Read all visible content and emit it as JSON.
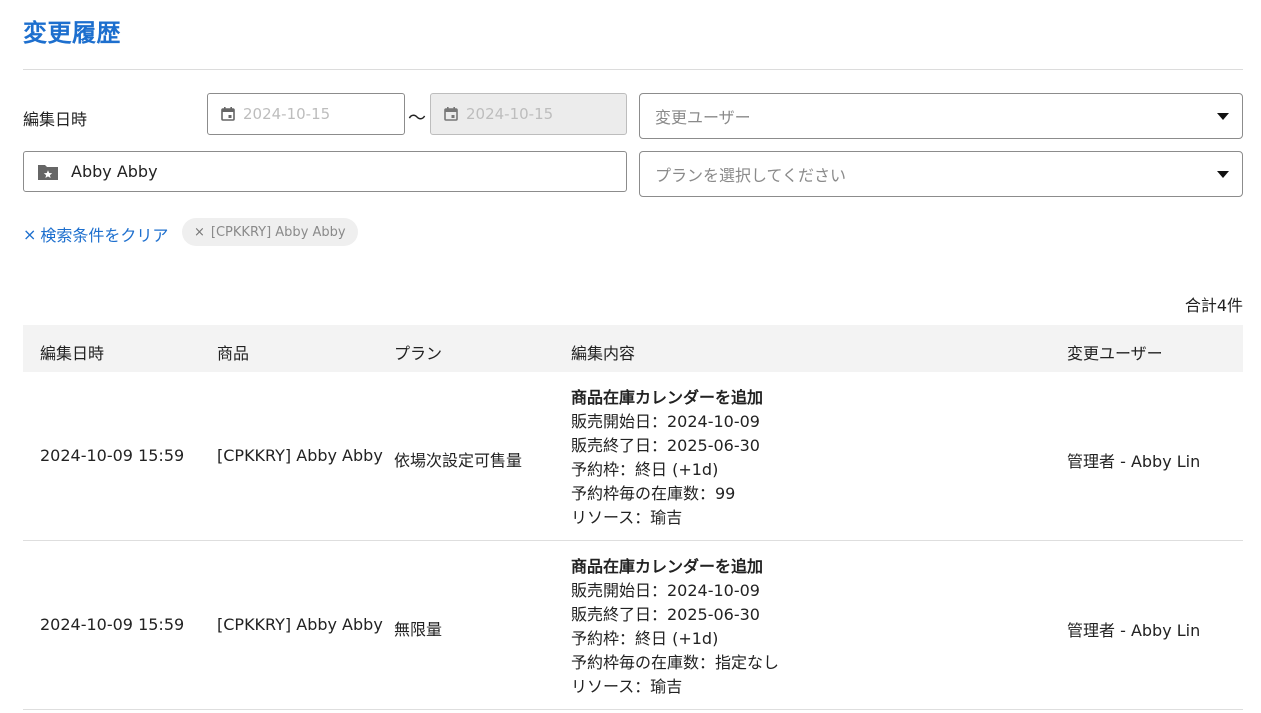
{
  "page": {
    "title": "変更履歴"
  },
  "filters": {
    "edit_date_label": "編集日時",
    "date_from_placeholder": "2024-10-15",
    "date_separator": "〜",
    "date_to_placeholder": "2024-10-15",
    "user_placeholder": "変更ユーザー",
    "product_value": "Abby Abby",
    "plan_placeholder": "プランを選択してください",
    "clear_label": "検索条件をクリア",
    "clear_symbol": "×",
    "chip_label": "[CPKKRY] Abby Abby",
    "chip_symbol": "×"
  },
  "summary": {
    "total": "合計4件"
  },
  "table": {
    "headers": [
      "編集日時",
      "商品",
      "プラン",
      "編集内容",
      "変更ユーザー"
    ],
    "rows": [
      {
        "datetime": "2024-10-09 15:59",
        "product": "[CPKKRY] Abby Abby",
        "plan": "依場次設定可售量",
        "content_title": "商品在庫カレンダーを追加",
        "content_lines": [
          "販売開始日：2024-10-09",
          "販売終了日：2025-06-30",
          "予約枠：終日 (+1d)",
          "予約枠毎の在庫数：99",
          "リソース：瑜吉"
        ],
        "user": "管理者 - Abby Lin"
      },
      {
        "datetime": "2024-10-09 15:59",
        "product": "[CPKKRY] Abby Abby",
        "plan": "無限量",
        "content_title": "商品在庫カレンダーを追加",
        "content_lines": [
          "販売開始日：2024-10-09",
          "販売終了日：2025-06-30",
          "予約枠：終日 (+1d)",
          "予約枠毎の在庫数：指定なし",
          "リソース：瑜吉"
        ],
        "user": "管理者 - Abby Lin"
      }
    ]
  },
  "colors": {
    "accent": "#1d6fce",
    "header_bg": "#f3f3f3",
    "chip_bg": "#efefef"
  },
  "icons": {
    "date": "calendar-icon",
    "product": "folder-star-icon",
    "select": "caret-down-icon",
    "clear": "close-icon"
  }
}
